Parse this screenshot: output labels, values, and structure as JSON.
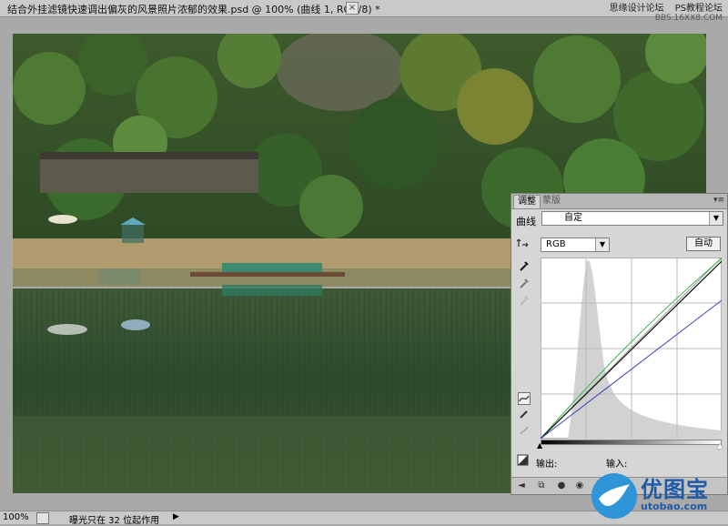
{
  "window": {
    "title": "结合外挂滤镜快速调出偏灰的风景照片浓郁的效果.psd @ 100% (曲线 1, RGB/8) *",
    "close_glyph": "×"
  },
  "watermark": {
    "site1": "思缘设计论坛",
    "site2": "PS教程论坛",
    "url": "BBS.16XX8.COM"
  },
  "adjustments_panel": {
    "tabs": [
      "调整",
      "蒙版"
    ],
    "menu_glyph": "▾≡",
    "curve_label": "曲线",
    "preset_value": "自定",
    "channel_value": "RGB",
    "auto_button": "自动",
    "output_label": "输出:",
    "input_label": "输入:",
    "curves": {
      "green": [
        [
          0,
          0
        ],
        [
          255,
          255
        ]
      ],
      "black_rgb": [
        [
          0,
          0
        ],
        [
          255,
          250
        ]
      ],
      "blue": [
        [
          0,
          0
        ],
        [
          255,
          195
        ]
      ]
    }
  },
  "status": {
    "zoom": "100%",
    "message": "曝光只在 32 位起作用",
    "play_glyph": "▶"
  },
  "logo": {
    "text": "优图宝",
    "url": "utobao.com"
  }
}
